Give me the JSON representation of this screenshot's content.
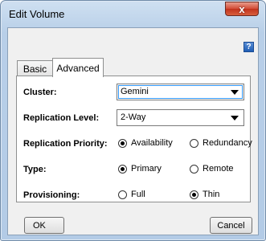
{
  "window": {
    "title": "Edit Volume",
    "close_glyph": "x"
  },
  "help_icon": "?",
  "tabs": [
    {
      "label": "Basic",
      "selected": false
    },
    {
      "label": "Advanced",
      "selected": true
    }
  ],
  "form": {
    "cluster": {
      "label": "Cluster:",
      "value": "Gemini"
    },
    "replication_level": {
      "label": "Replication Level:",
      "value": "2-Way"
    },
    "replication_priority": {
      "label": "Replication Priority:",
      "options": [
        "Availability",
        "Redundancy"
      ],
      "selected": "Availability"
    },
    "type": {
      "label": "Type:",
      "options": [
        "Primary",
        "Remote"
      ],
      "selected": "Primary"
    },
    "provisioning": {
      "label": "Provisioning:",
      "options": [
        "Full",
        "Thin"
      ],
      "selected": "Thin"
    }
  },
  "buttons": {
    "ok": "OK",
    "cancel": "Cancel"
  },
  "colors": {
    "title_bar": "#b8cfe8",
    "close_button": "#c9402a",
    "focus": "#3399ff"
  }
}
